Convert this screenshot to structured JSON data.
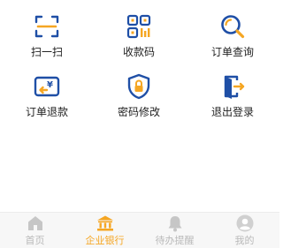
{
  "colors": {
    "icon_blue": "#1f4fa6",
    "icon_orange": "#f5a623",
    "text": "#222222",
    "tab_active": "#f5a623",
    "tab_inactive": "#b9b9b9",
    "tabbar_bg": "#f7f7f7"
  },
  "actions": [
    {
      "label": "扫一扫",
      "icon": "scan-icon"
    },
    {
      "label": "收款码",
      "icon": "qr-code-icon"
    },
    {
      "label": "订单查询",
      "icon": "search-order-icon"
    },
    {
      "label": "订单退款",
      "icon": "refund-icon"
    },
    {
      "label": "密码修改",
      "icon": "password-shield-icon"
    },
    {
      "label": "退出登录",
      "icon": "logout-icon"
    }
  ],
  "tabbar": {
    "active_index": 1,
    "tabs": [
      {
        "label": "首页",
        "icon": "home-icon"
      },
      {
        "label": "企业银行",
        "icon": "bank-icon"
      },
      {
        "label": "待办提醒",
        "icon": "bell-icon"
      },
      {
        "label": "我的",
        "icon": "profile-icon"
      }
    ]
  }
}
